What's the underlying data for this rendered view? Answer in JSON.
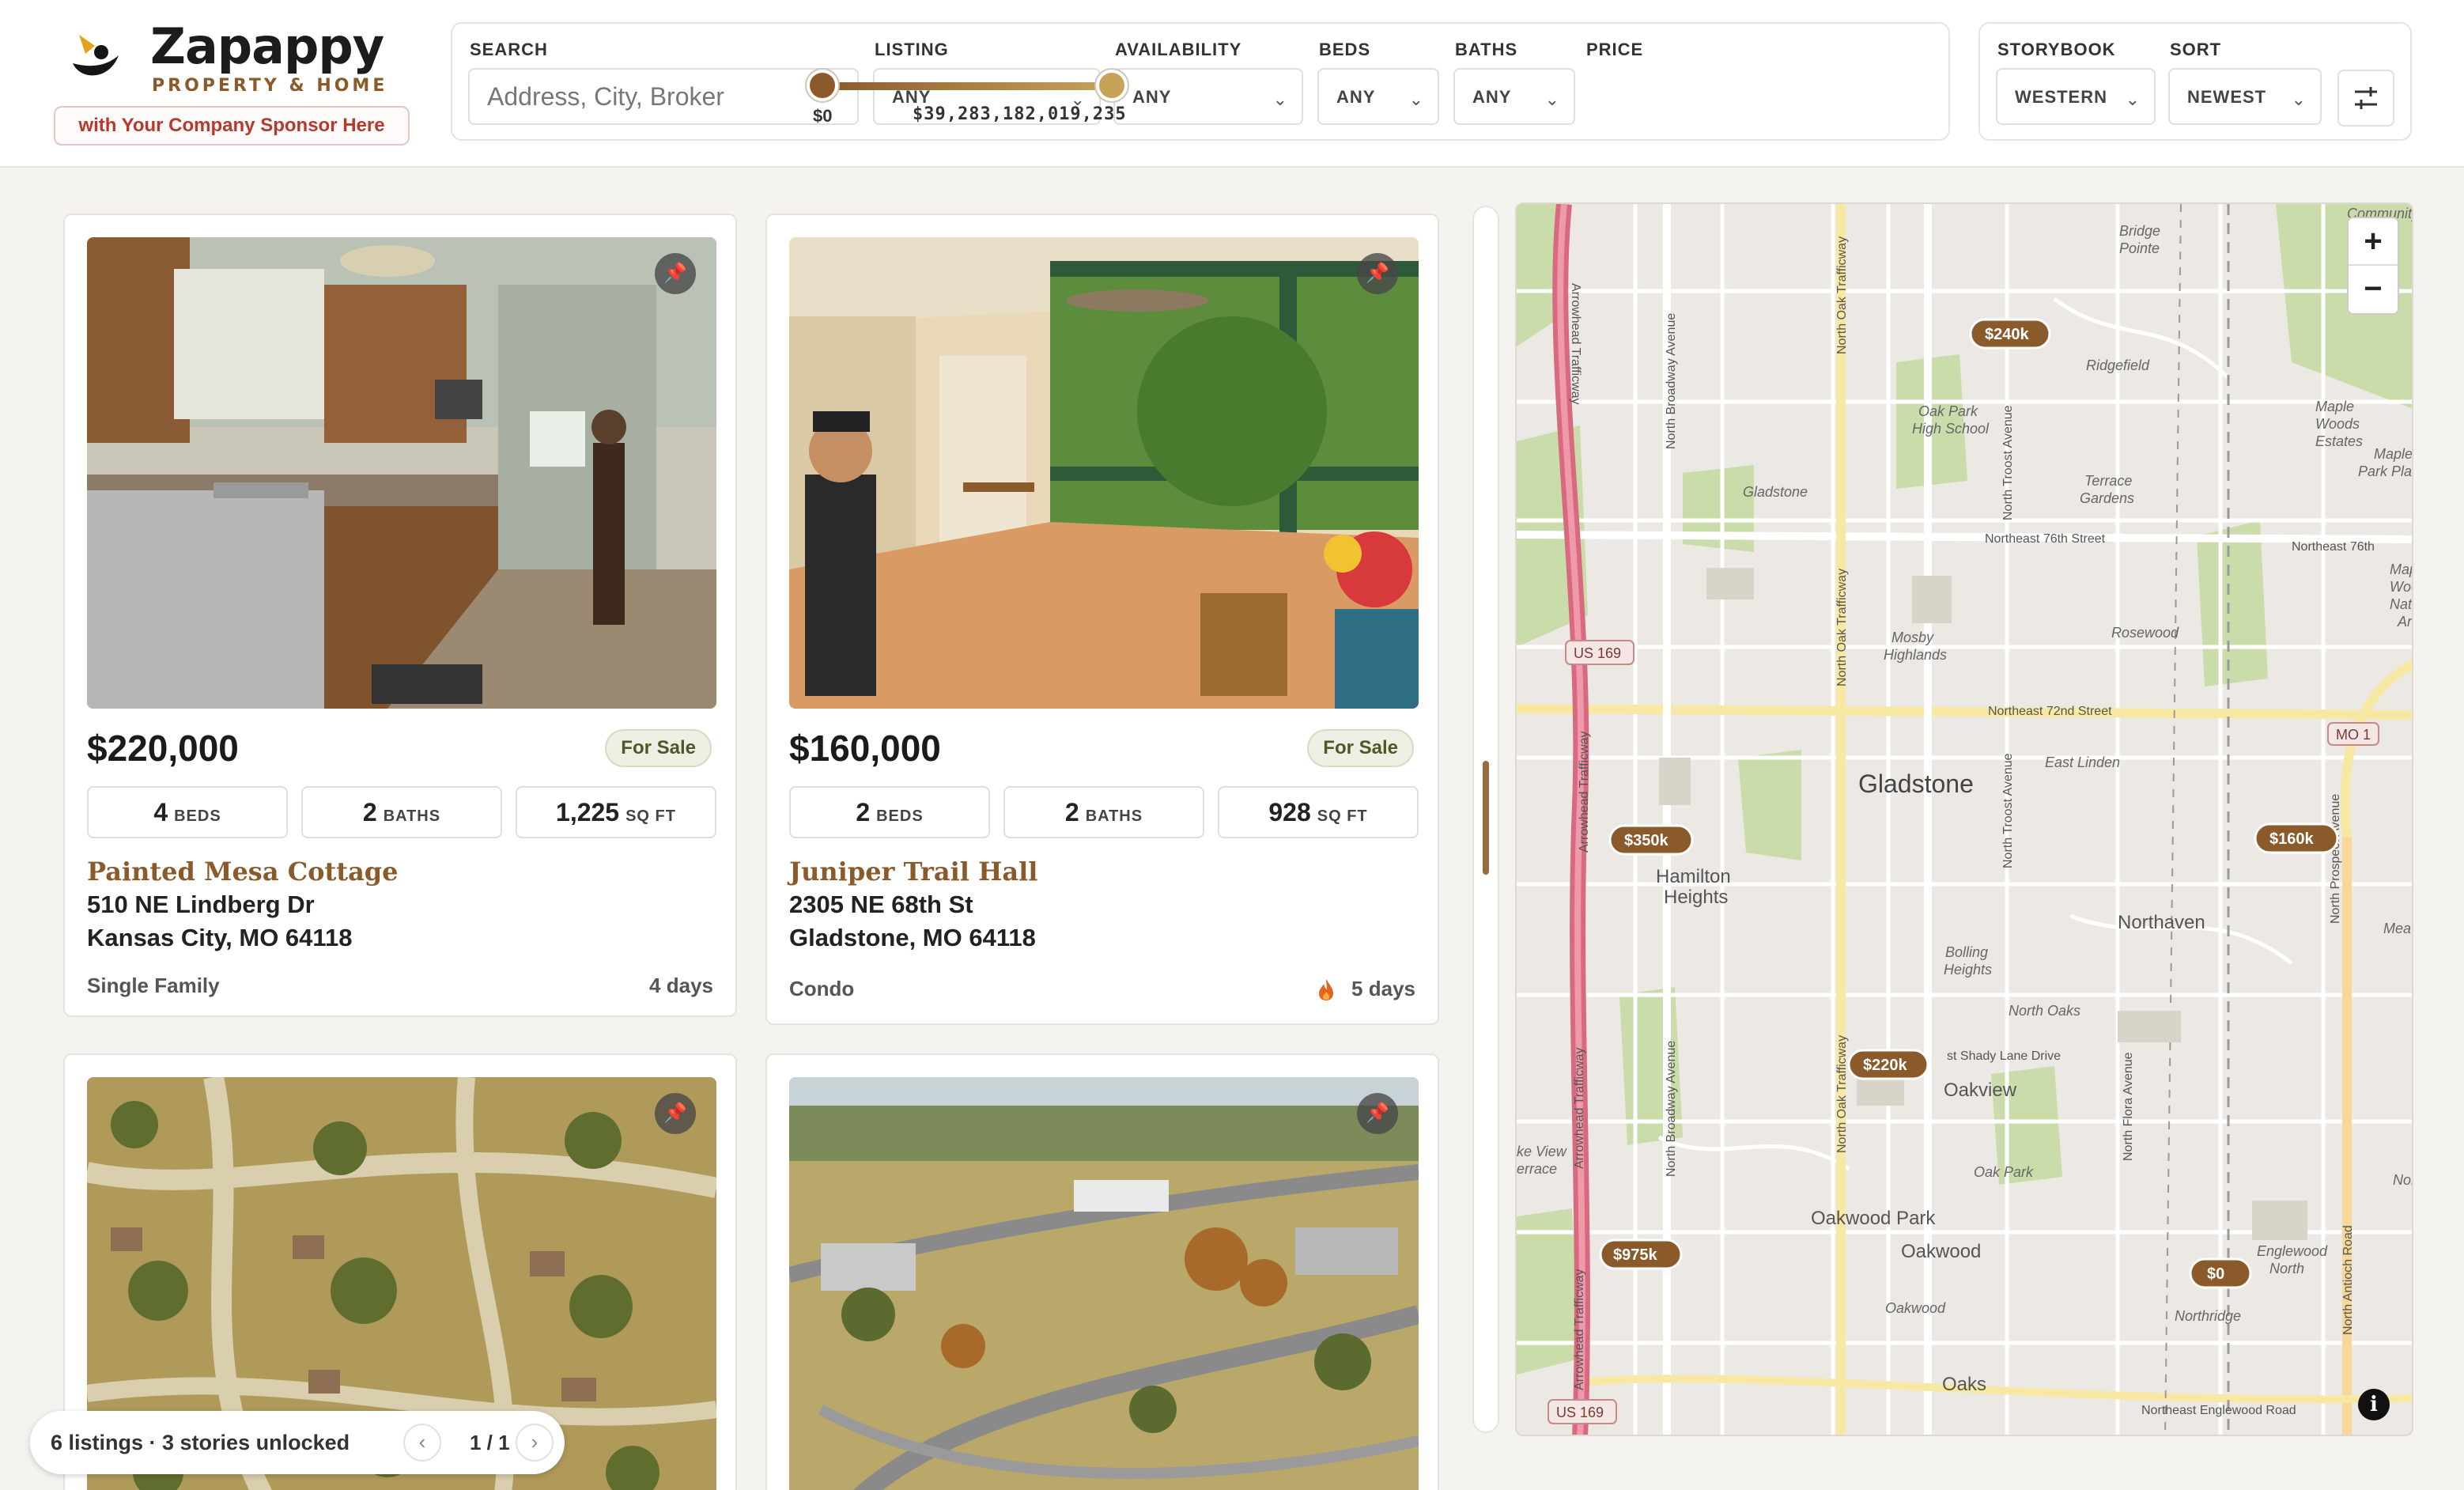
{
  "brand": {
    "name": "Zapappy",
    "tagline": "PROPERTY & HOME",
    "sponsor": "with Your Company Sponsor Here",
    "colors": {
      "accent": "#8a5a2b",
      "gold": "#c7a35a",
      "sponsor": "#b53a2d"
    }
  },
  "filters": {
    "search": {
      "label": "SEARCH",
      "placeholder": "Address, City, Broker"
    },
    "listing": {
      "label": "LISTING",
      "value": "ANY"
    },
    "availability": {
      "label": "AVAILABILITY",
      "value": "ANY"
    },
    "beds": {
      "label": "BEDS",
      "value": "ANY"
    },
    "baths": {
      "label": "BATHS",
      "value": "ANY"
    },
    "price": {
      "label": "PRICE",
      "min": "$0",
      "max": "$39,283,182,019,235"
    }
  },
  "options": {
    "storybook": {
      "label": "STORYBOOK",
      "value": "WESTERN"
    },
    "sort": {
      "label": "SORT",
      "value": "NEWEST"
    },
    "tune_icon": "sliders-icon"
  },
  "listings": [
    {
      "price": "$220,000",
      "status": "For Sale",
      "beds": "4",
      "beds_unit": "BEDS",
      "baths": "2",
      "baths_unit": "BATHS",
      "sqft": "1,225",
      "sqft_unit": "SQ FT",
      "name": "Painted Mesa Cottage",
      "street": "510 NE Lindberg Dr",
      "city": "Kansas City, MO 64118",
      "type": "Single Family",
      "age": "4 days",
      "hot": false
    },
    {
      "price": "$160,000",
      "status": "For Sale",
      "beds": "2",
      "beds_unit": "BEDS",
      "baths": "2",
      "baths_unit": "BATHS",
      "sqft": "928",
      "sqft_unit": "SQ FT",
      "name": "Juniper Trail Hall",
      "street": "2305 NE 68th St",
      "city": "Gladstone, MO 64118",
      "type": "Condo",
      "age": "5 days",
      "hot": true
    },
    {
      "photo": "aerial-neighborhood"
    },
    {
      "photo": "aerial-highway-field"
    }
  ],
  "map": {
    "zoom_in": "+",
    "zoom_out": "−",
    "info": "i",
    "markers": [
      "$240k",
      "$350k",
      "$160k",
      "$220k",
      "$975k",
      "$0"
    ],
    "labels": {
      "community": "Community",
      "bridge1": "Bridge",
      "bridge2": "Pointe",
      "ridgefield": "Ridgefield",
      "oakpark1": "Oak Park",
      "oakpark2": "High School",
      "maple1": "Maple",
      "maple2": "Woods",
      "maple3": "Estates",
      "maple4": "Maple",
      "maple5": "Park Place",
      "gladstone_small": "Gladstone",
      "terrace1": "Terrace",
      "terrace2": "Gardens",
      "ne76": "Northeast 76th Street",
      "ne76b": "Northeast 76th",
      "mw1": "Maple",
      "mw2": "Woods",
      "mw3": "Natural",
      "mw4": "Area",
      "us169a": "US 169",
      "us169b": "US 169",
      "mo1": "MO 1",
      "mosby1": "Mosby",
      "mosby2": "Highlands",
      "rosewood": "Rosewood",
      "ne72": "Northeast 72nd Street",
      "eastlinden": "East Linden",
      "gladstone": "Gladstone",
      "hamilton1": "Hamilton",
      "hamilton2": "Heights",
      "northaven": "Northaven",
      "mea": "Mea",
      "bolling1": "Bolling",
      "bolling2": "Heights",
      "northoaks": "North Oaks",
      "shadylane": "st Shady Lane Drive",
      "oakview": "Oakview",
      "lakeview1": "ke View",
      "lakeview2": "errace",
      "oakpark": "Oak Park",
      "oakwoodpark": "Oakwood Park",
      "oakwood": "Oakwood",
      "oakwood2": "Oakwood",
      "englewood1": "Englewood",
      "englewood2": "North",
      "northridge": "Northridge",
      "oaks": "Oaks",
      "neenglewood": "Northeast Englewood Road",
      "northe": "Northe",
      "arrowhead": "Arrowhead Trafficway",
      "nbroadway": "North Broadway Avenue",
      "noak": "North Oak Trafficway",
      "ntroost": "North Troost Avenue",
      "nflora": "North Flora Avenue",
      "nprospect": "North Prospect Avenue",
      "nantioch": "North Antioch Road"
    }
  },
  "pager": {
    "summary": "6 listings · 3 stories unlocked",
    "page": "1 / 1",
    "prev": "‹",
    "next": "›"
  }
}
